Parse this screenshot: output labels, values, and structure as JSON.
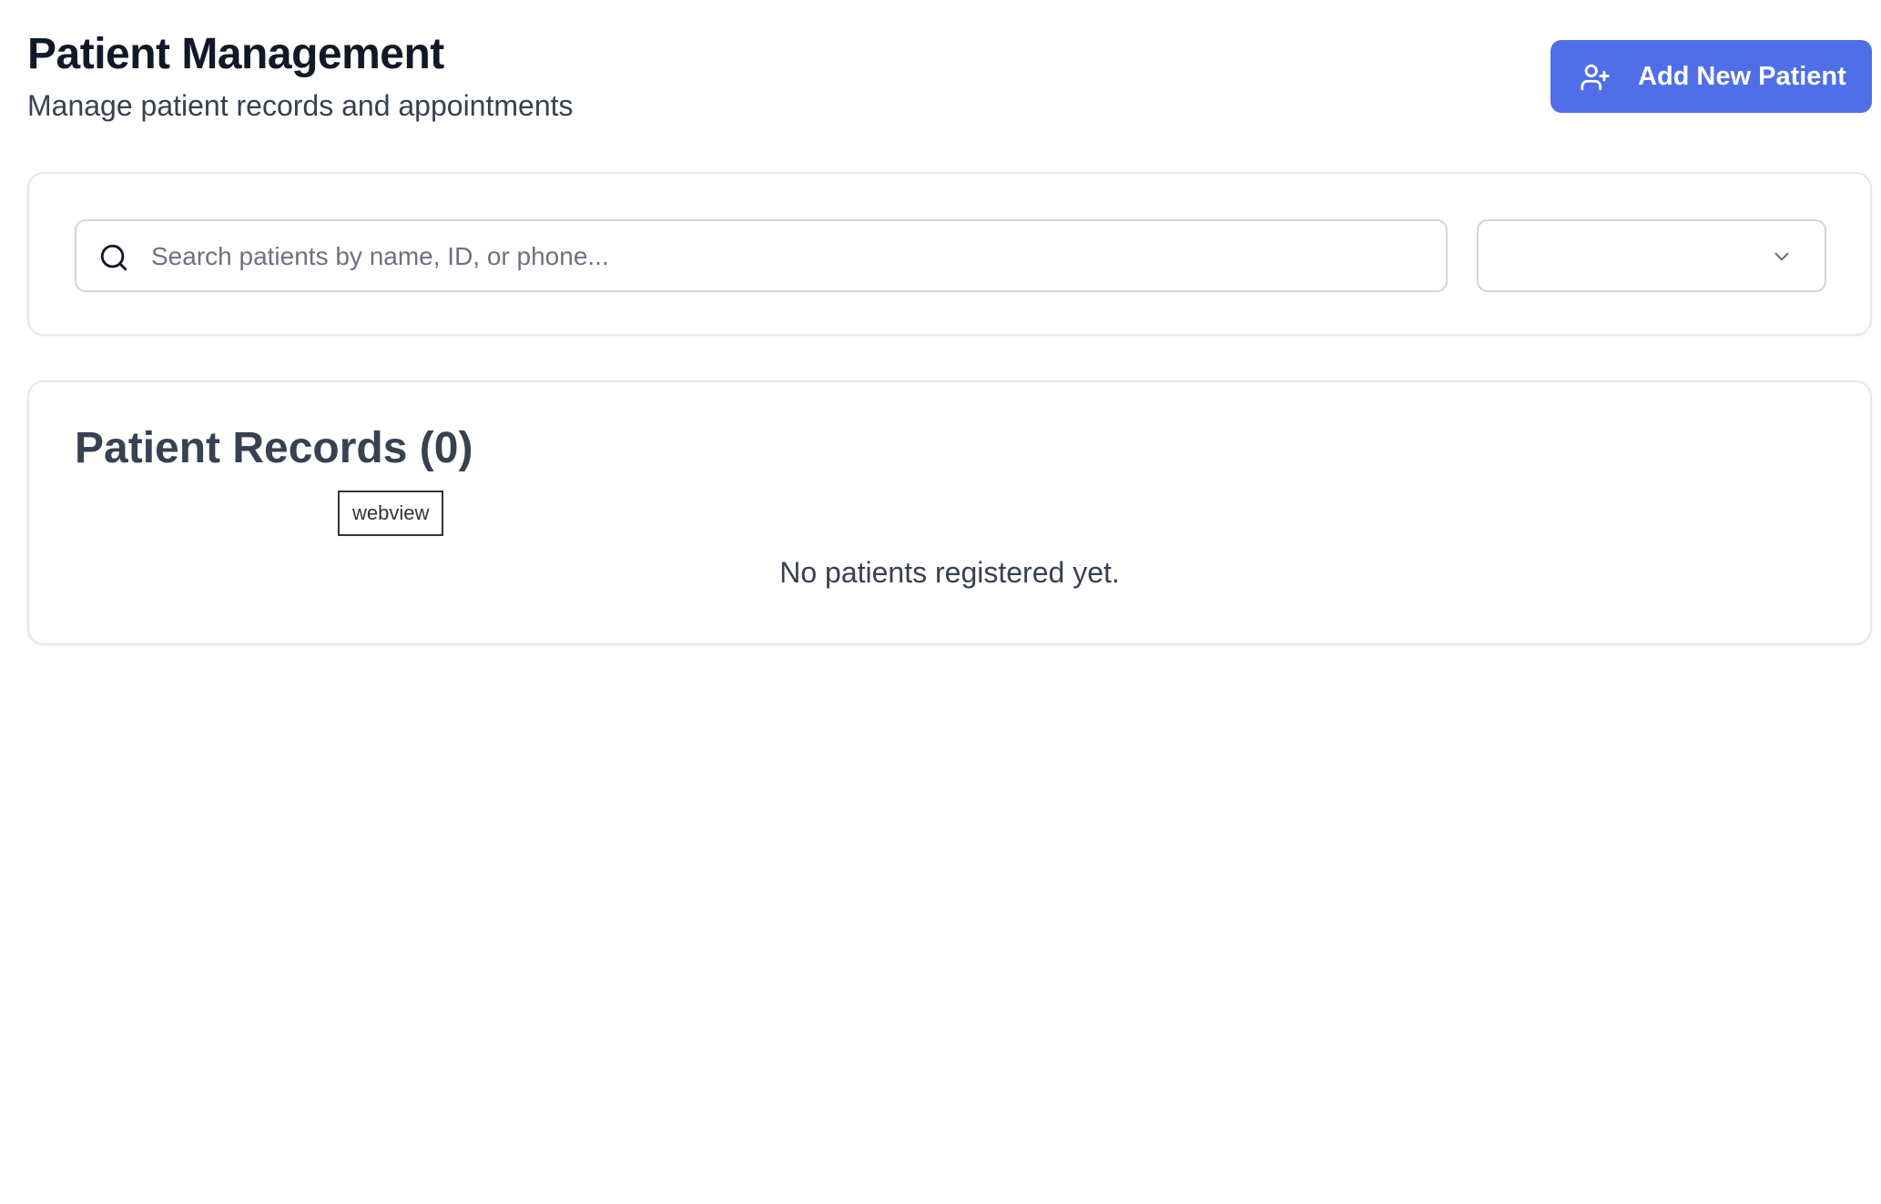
{
  "header": {
    "title": "Patient Management",
    "subtitle": "Manage patient records and appointments",
    "add_button": {
      "label": "Add New Patient",
      "icon": "user-plus-icon",
      "color": "#4f6ee8"
    }
  },
  "search": {
    "icon": "search-icon",
    "placeholder": "Search patients by name, ID, or phone...",
    "value": ""
  },
  "filter": {
    "selected": "",
    "icon": "chevron-down-icon"
  },
  "records": {
    "title": "Patient Records (0)",
    "count": 0,
    "webview_label": "webview",
    "empty_message": "No patients registered yet."
  }
}
